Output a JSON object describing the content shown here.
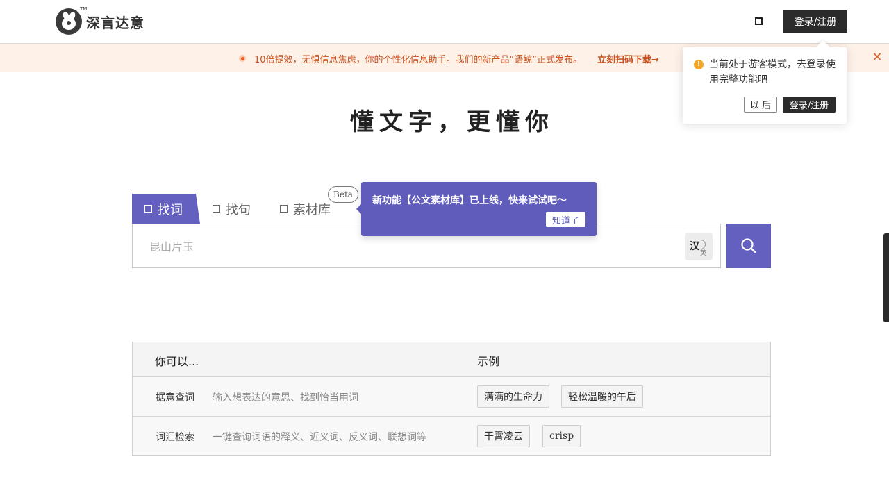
{
  "header": {
    "logo_text": "深言达意",
    "logo_tm": "TM",
    "login_label": "登录/注册",
    "icon_square": "square-icon"
  },
  "banner": {
    "text": "10倍提效，无惧信息焦虑，你的个性化信息助手。我们的新产品“语鲸”正式发布。",
    "link": "立刻扫码下载→",
    "close_icon": "close-icon",
    "color": "#c9521e"
  },
  "hero": {
    "title": "懂文字，更懂你"
  },
  "tabs": [
    {
      "label": "找词",
      "active": true
    },
    {
      "label": "找句",
      "active": false
    },
    {
      "label": "素材库",
      "active": false
    }
  ],
  "beta_badge": "Beta",
  "search": {
    "placeholder": "昆山片玉",
    "lang_toggle_han": "汉",
    "lang_toggle_ying": "英",
    "button_icon": "search-icon"
  },
  "feature_tooltip": {
    "text": "新功能【公文素材库】已上线，快来试试吧～",
    "button": "知道了"
  },
  "guest_popover": {
    "text": "当前处于游客模式，去登录使用完整功能吧",
    "later": "以 后",
    "login": "登录/注册"
  },
  "tips_table": {
    "header_left": "你可以...",
    "header_right": "示例",
    "rows": [
      {
        "name": "据意查词",
        "desc": "输入想表达的意思、找到恰当用词",
        "examples": [
          "满满的生命力",
          "轻松温暖的午后"
        ]
      },
      {
        "name": "词汇检索",
        "desc": "一键查询词语的释义、近义词、反义词、联想词等",
        "examples": [
          "干霄凌云",
          "crisp"
        ]
      }
    ]
  },
  "colors": {
    "accent": "#6360bf",
    "dark": "#2b2b2b",
    "banner_bg": "#fdf1e8",
    "warn": "#f5a623"
  }
}
